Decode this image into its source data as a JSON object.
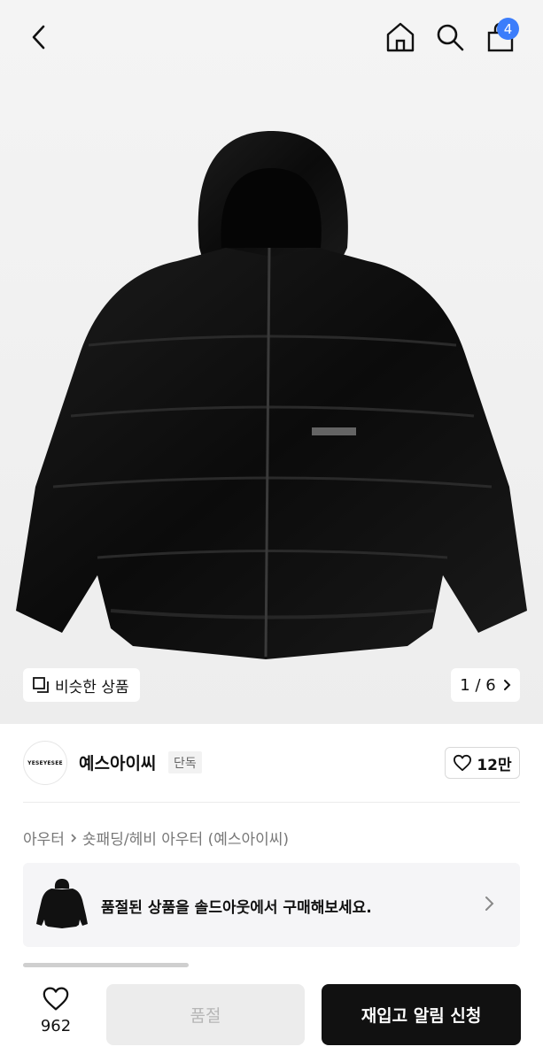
{
  "header": {
    "cart_count": "4",
    "icons": [
      "back-arrow-icon",
      "home-icon",
      "search-icon",
      "shopping-bag-icon"
    ]
  },
  "gallery": {
    "similar_label": "비슷한 상품",
    "page_indicator": "1 / 6",
    "current_page": 1,
    "total_pages": 6
  },
  "brand": {
    "logo_text": "YESEYESEE",
    "name": "예스아이씨",
    "exclusive_tag": "단독",
    "likes": "12만"
  },
  "breadcrumb": {
    "category": "아우터",
    "subcategory": "숏패딩/헤비 아우터 (예스아이씨)"
  },
  "soldout_banner": {
    "message": "품절된 상품을 솔드아웃에서 구매해보세요."
  },
  "bottom_bar": {
    "wish_count": "962",
    "soldout_label": "품절",
    "restock_label": "재입고 알림 신청"
  },
  "colors": {
    "badge": "#3b7dfb",
    "primary_button": "#111111",
    "disabled_button": "#ececec"
  }
}
